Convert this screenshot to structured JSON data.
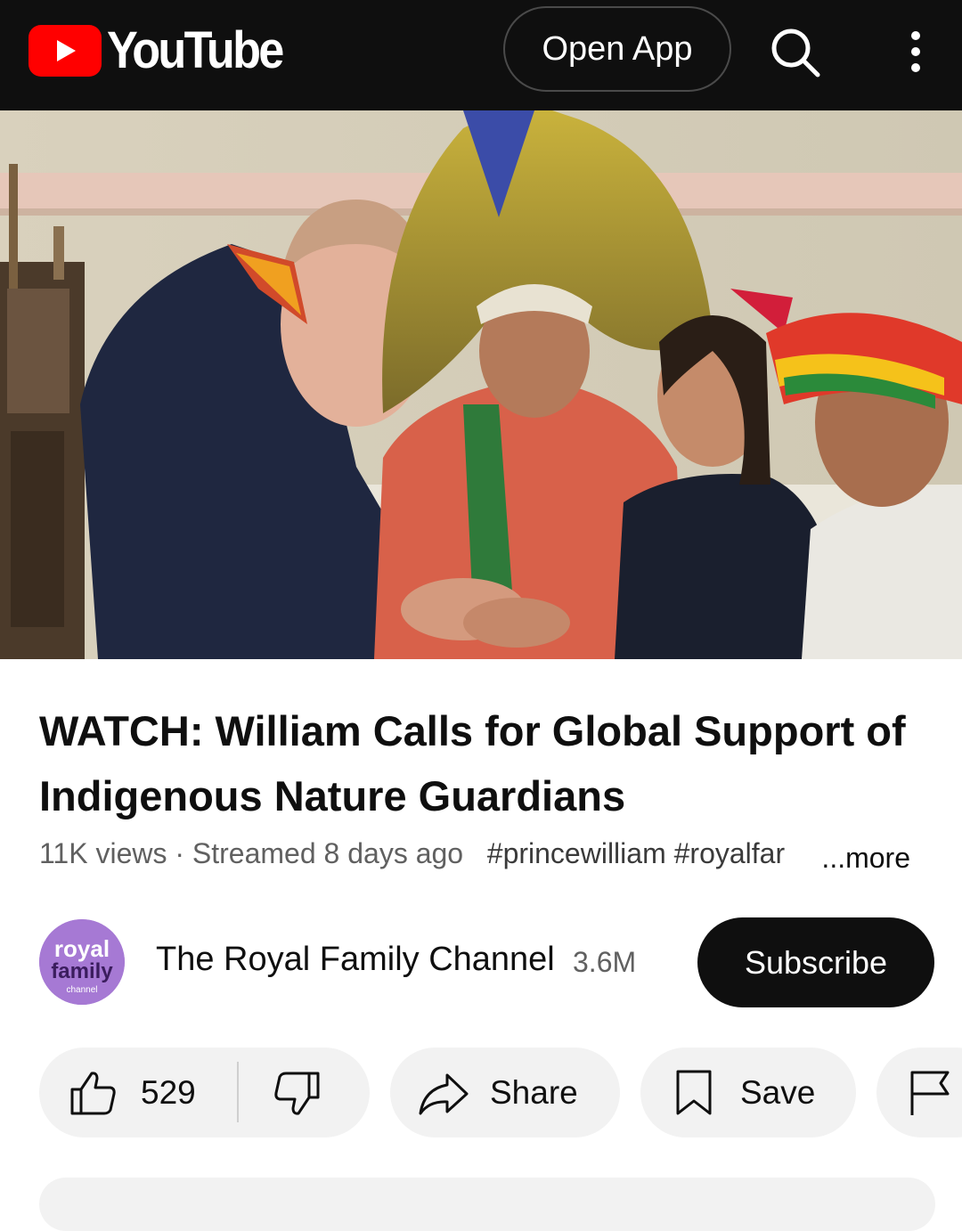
{
  "header": {
    "logo_text": "YouTube",
    "open_app_label": "Open App",
    "search_icon": "search-icon",
    "more_icon": "more-vert-icon"
  },
  "video": {
    "thumbnail": "video-frame"
  },
  "info": {
    "title": "WATCH: William Calls for Global Support of Indigenous Nature Guardians",
    "views": "11K views",
    "separator": " · ",
    "streamed": "Streamed 8 days ago",
    "tags": "#princewilliam #royalfar",
    "more_label": "...more"
  },
  "channel": {
    "avatar_text_1": "royal",
    "avatar_text_2": "family",
    "avatar_text_3": "channel",
    "name": "The Royal Family Channel",
    "subscribers": "3.6M",
    "subscribe_label": "Subscribe"
  },
  "actions": {
    "like_count": "529",
    "share_label": "Share",
    "save_label": "Save"
  },
  "colors": {
    "topbar": "#0f0f0f",
    "brand_red": "#ff0000",
    "pill_bg": "#f2f2f2",
    "avatar": "#a679d4"
  }
}
